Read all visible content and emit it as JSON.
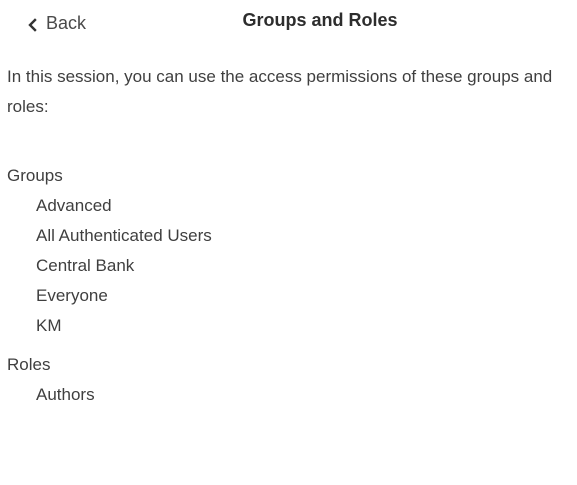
{
  "header": {
    "back_label": "Back",
    "title": "Groups and Roles"
  },
  "intro": "In this session, you can use the access permissions of these groups and roles:",
  "groups": {
    "heading": "Groups",
    "items": [
      "Advanced",
      "All Authenticated Users",
      "Central Bank",
      "Everyone",
      "KM"
    ]
  },
  "roles": {
    "heading": "Roles",
    "items": [
      "Authors"
    ]
  },
  "icons": {
    "back": "chevron-left-icon"
  },
  "colors": {
    "text": "#3f3f3f",
    "title": "#2d2d2d",
    "background": "#ffffff"
  }
}
